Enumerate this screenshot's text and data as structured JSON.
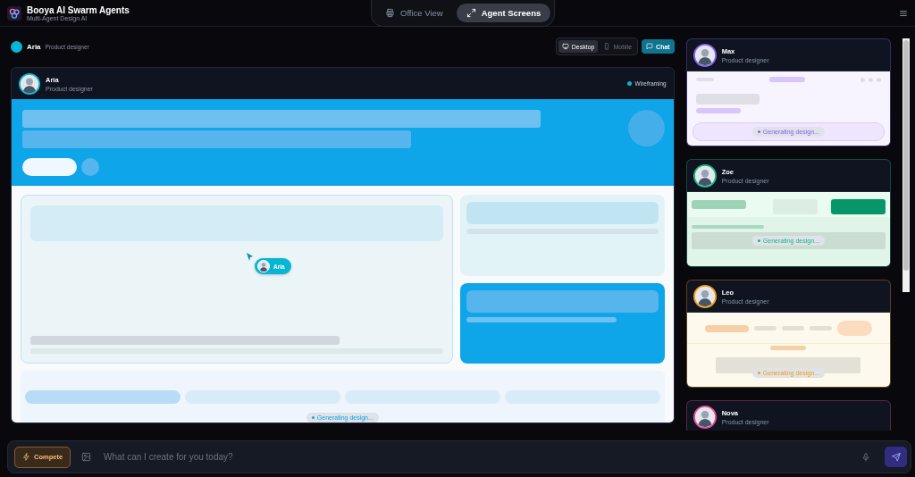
{
  "app": {
    "title": "Booya AI Swarm Agents",
    "subtitle": "Multi-Agent Design AI"
  },
  "view_tabs": [
    {
      "label": "Office View",
      "selected": false
    },
    {
      "label": "Agent Screens",
      "selected": true
    }
  ],
  "active_agent": {
    "name": "Aria",
    "role": "Product designer",
    "color": "#06b6d4"
  },
  "device_toggle": [
    {
      "label": "Desktop",
      "selected": true
    },
    {
      "label": "Mobile",
      "selected": false
    }
  ],
  "chat_button": "Chat",
  "preview": {
    "agent": "Aria",
    "role": "Product designer",
    "status": "Wireframing",
    "cursor_label": "Aria",
    "chip": "Generating design..."
  },
  "agents": [
    {
      "name": "Max",
      "role": "Product designer",
      "color": "#8b5cf6",
      "kind": "dashboard",
      "chip": "Generating design..."
    },
    {
      "name": "Zoe",
      "role": "Product designer",
      "color": "#10b981",
      "kind": "form",
      "chip": "Generating design..."
    },
    {
      "name": "Leo",
      "role": "Product designer",
      "color": "#f59e0b",
      "kind": "nav",
      "chip": "Generating design..."
    },
    {
      "name": "Nova",
      "role": "Product designer",
      "color": "#ec4899",
      "kind": "hidden"
    }
  ],
  "prompt": {
    "button": "Compete",
    "placeholder": "What can I create for you today?"
  }
}
